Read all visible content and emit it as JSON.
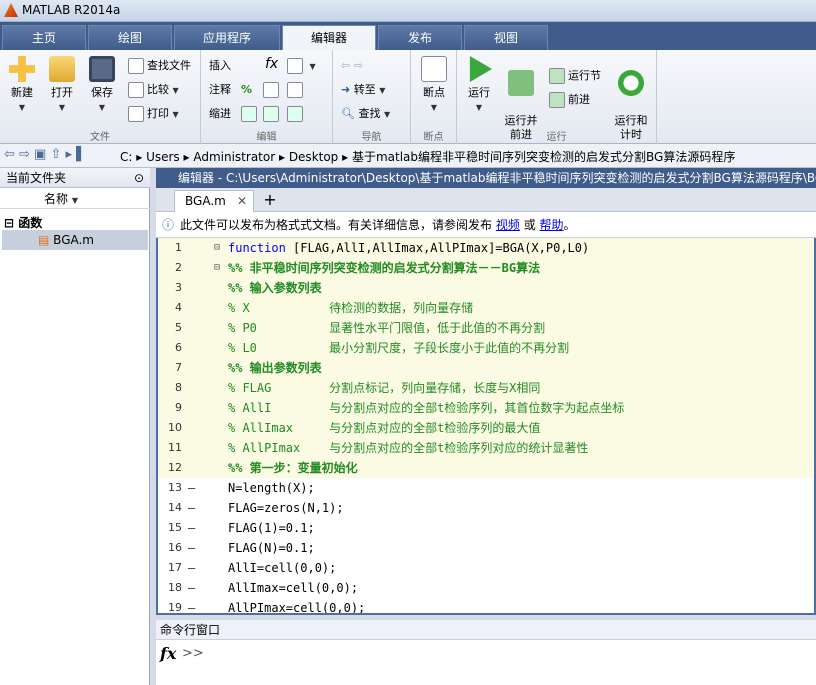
{
  "title": "MATLAB R2014a",
  "tabs": [
    "主页",
    "绘图",
    "应用程序",
    "编辑器",
    "发布",
    "视图"
  ],
  "ribbon": {
    "file": {
      "label": "文件",
      "new": "新建",
      "open": "打开",
      "save": "保存",
      "find_files": "查找文件",
      "compare": "比较",
      "print": "打印"
    },
    "edit": {
      "label": "编辑",
      "insert": "插入",
      "comment": "注释",
      "indent": "缩进",
      "fx": "fx"
    },
    "nav": {
      "label": "导航",
      "goto": "转至",
      "find": "查找"
    },
    "bp": {
      "label": "断点",
      "breakpoints": "断点"
    },
    "run": {
      "label": "运行",
      "run": "运行",
      "run_advance": "运行并\n前进",
      "run_section": "运行节",
      "advance": "前进",
      "run_time": "运行和\n计时"
    }
  },
  "address": {
    "segments": [
      "C:",
      "Users",
      "Administrator",
      "Desktop",
      "基于matlab编程非平稳时间序列突变检测的启发式分割BG算法源码程序"
    ]
  },
  "left": {
    "header": "当前文件夹",
    "col_name": "名称",
    "group": "函数",
    "file": "BGA.m"
  },
  "editor": {
    "header": "编辑器 - C:\\Users\\Administrator\\Desktop\\基于matlab编程非平稳时间序列突变检测的启发式分割BG算法源码程序\\BGA.m",
    "tab": "BGA.m",
    "add_tab": "+",
    "info": {
      "text1": "此文件可以发布为格式式文档。有关详细信息，请参阅发布",
      "link1": "视频",
      "or": "或",
      "link2": "帮助",
      "end": "。"
    },
    "lines": [
      {
        "n": "1",
        "dash": "",
        "kw": "function",
        "code": " [FLAG,AllI,AllImax,AllPImax]=BGA(X,P0,L0)",
        "type": "func"
      },
      {
        "n": "2",
        "dash": "",
        "code": "%% 非平稳时间序列突变检测的启发式分割算法－－BG算法",
        "type": "cell"
      },
      {
        "n": "3",
        "dash": "",
        "code": "%% 输入参数列表",
        "type": "cell"
      },
      {
        "n": "4",
        "dash": "",
        "code": "% X           待检测的数据，列向量存储",
        "type": "cm"
      },
      {
        "n": "5",
        "dash": "",
        "code": "% P0          显著性水平门限值，低于此值的不再分割",
        "type": "cm"
      },
      {
        "n": "6",
        "dash": "",
        "code": "% L0          最小分割尺度，子段长度小于此值的不再分割",
        "type": "cm"
      },
      {
        "n": "7",
        "dash": "",
        "code": "%% 输出参数列表",
        "type": "cell"
      },
      {
        "n": "8",
        "dash": "",
        "code": "% FLAG        分割点标记，列向量存储，长度与X相同",
        "type": "cm"
      },
      {
        "n": "9",
        "dash": "",
        "code": "% AllI        与分割点对应的全部t检验序列，其首位数字为起点坐标",
        "type": "cm"
      },
      {
        "n": "10",
        "dash": "",
        "code": "% AllImax     与分割点对应的全部t检验序列的最大值",
        "type": "cm"
      },
      {
        "n": "11",
        "dash": "",
        "code": "% AllPImax    与分割点对应的全部t检验序列对应的统计显著性",
        "type": "cm"
      },
      {
        "n": "12",
        "dash": "",
        "code": "%% 第一步：变量初始化",
        "type": "cell"
      },
      {
        "n": "13",
        "dash": "–",
        "code": "N=length(X);",
        "type": "plain"
      },
      {
        "n": "14",
        "dash": "–",
        "code": "FLAG=zeros(N,1);",
        "type": "plain"
      },
      {
        "n": "15",
        "dash": "–",
        "code": "FLAG(1)=0.1;",
        "type": "plain"
      },
      {
        "n": "16",
        "dash": "–",
        "code": "FLAG(N)=0.1;",
        "type": "plain"
      },
      {
        "n": "17",
        "dash": "–",
        "code": "AllI=cell(0,0);",
        "type": "plain"
      },
      {
        "n": "18",
        "dash": "–",
        "code": "AllImax=cell(0,0);",
        "type": "plain"
      },
      {
        "n": "19",
        "dash": "–",
        "code": "AllPImax=cell(0,0);",
        "type": "plain"
      }
    ]
  },
  "command": {
    "header": "命令行窗口",
    "fx": "fx",
    "prompt": ">>"
  }
}
